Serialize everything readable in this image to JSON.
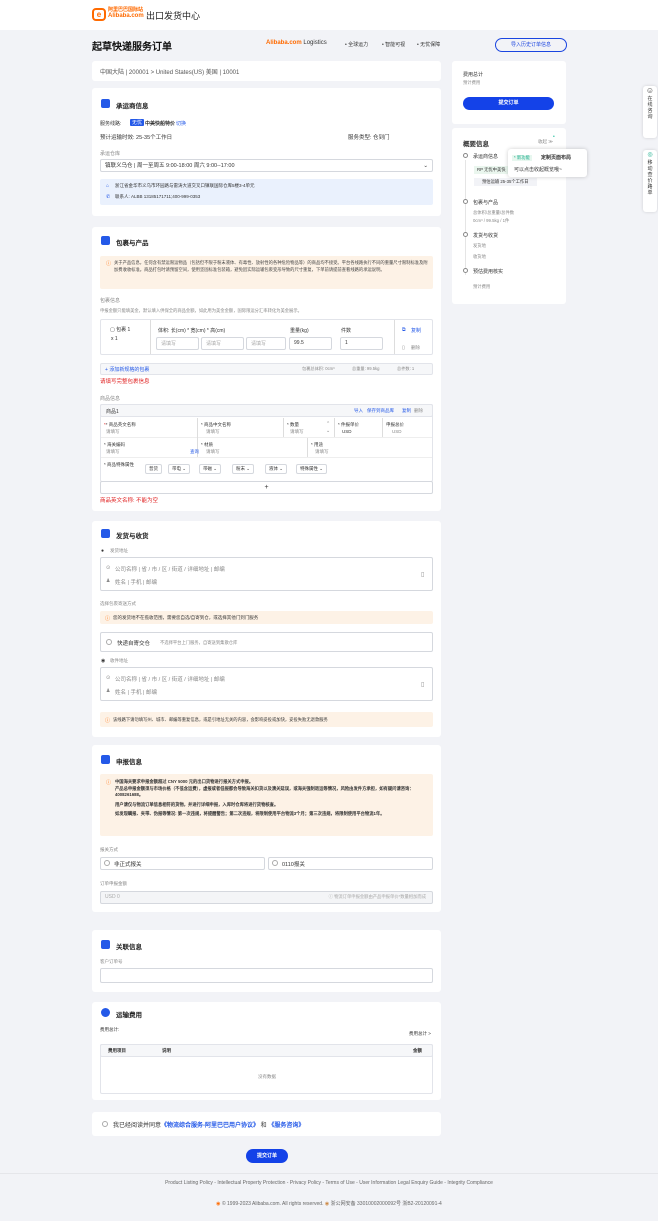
{
  "header": {
    "logo_cn": "阿里巴巴国际站",
    "logo_en": "Alibaba.com",
    "title": "出口发货中心"
  },
  "page": {
    "title": "起草快递服务订单",
    "brand_a": "Alibaba.com",
    "brand_b": " Logistics",
    "features": [
      "• 全球运力",
      "• 智能可视",
      "• 无忧保障"
    ],
    "import_history": "导入历史订单信息"
  },
  "route": "中国大陆 | 200001 > United States(US) 美国 | 10001",
  "carrier": {
    "title": "承运商信息",
    "service_label": "服务线路:",
    "tag": "无忧",
    "service": "中美快船特价",
    "switch": "切换",
    "time": "预计运输时效: 25-35个工作日",
    "type": "服务类型: 仓到门",
    "warehouse_label": "承运仓库",
    "warehouse": "镇联义乌仓 | 周一至周五 9:00-18:00 周六 9:00--17:00",
    "address": "浙江省金华市义乌市环园路与雷涛大道交叉口镇联国际仓库5楼3-4单元",
    "contact": "联系人: ALBB 13185171711;400-999-0353"
  },
  "packages": {
    "title": "包裹与产品",
    "notice": "关于产品信息，任何含有禁运限运物品（包括但不限于粉末液体、有毒性、放射性的各种危险物品等）的商品均不接受。平台各线路执行不同的重量尺寸限制标准及附加费收收标准。商品打包时请预留空间，使用坚固标准包装箱，避免因实际运输包裹变形导致的尺寸重复，下单前请提前查看线路的承运说明。",
    "info_label": "包裹信息",
    "info_hint": "申报金额只能填美金，默认填入供保全的商品金额，如此用为美金金额，国际限运分汇率转化为美金展示。",
    "pkg_name": "包裹 1",
    "pkg_qty": "x 1",
    "dims_label": "体积: 长(cm) * 宽(cm) * 高(cm)",
    "weight_label": "重量(kg)",
    "count_label": "件数",
    "ph": "请填写",
    "weight": "99.5",
    "count": "1",
    "copy": "复制",
    "delete": "删除",
    "add": "添加新规格的包裹",
    "total_vol": "包裹总体积: 0cm³",
    "total_weight": "总重量: 99.5kg",
    "total_count": "总件数: 1",
    "error1": "请填写完整包裹信息",
    "goods_label": "商品信息",
    "goods1": "商品1",
    "import": "导入",
    "save": "保存到商品库",
    "copy2": "复制",
    "delete2": "删除",
    "en_name": "* 商品英文名称",
    "cn_name": "* 商品中文名称",
    "qty": "* 数量",
    "unit_price": "* 件报单价",
    "price_total": "申报总价",
    "usd": "USD",
    "customs_code": "* 海关编码",
    "query": "查询",
    "material": "* 材质",
    "purpose": "* 用途",
    "attr": "* 商品特殊属性",
    "attrs": [
      "普货",
      "带电",
      "带磁",
      "粉末",
      "液体",
      "特殊属性"
    ],
    "plus": "+",
    "error2": "商品英文名称: 不能为空"
  },
  "shipping": {
    "title": "发货与收货",
    "sender_label": "发货地址",
    "addr_ph": "公司名称  |  省 / 市 / 区 / 街道 / 详细地址  |  邮编",
    "person_ph": "姓名  |  手机  |  邮编",
    "method_label": "选择包裹寄送方式",
    "method_note": "您的发货地不在揽收范围，需要您自选/自寄到仓，或选择其他门到门服务",
    "method": "快递自寄交仓",
    "method_hint": "不选择平台上门服务，自寄送到集散仓库",
    "receiver_label": "收件地址",
    "warn": "该线路下请勿填写州、城市、邮编等重复信息，或是引地址无关的内容，会影响妥投或加快，妥投失败无退款服务"
  },
  "declare": {
    "title": "申报信息",
    "notice1": "中国海关要求申报金额超过 CNY 5000 元的出口货物进行报关方式申报。",
    "notice2": "产品总申报金额须与市场价格（不低含运费），虚报或者低报都会导致海关扣货以及清关延误，或海关强制退运等情况，风险由发件方承担，如有疑问请咨询：4008261688。",
    "notice3": "用户请仅与物流订单信息相符的货物，并进行详细申报，入库时仓库将进行货物核查。",
    "notice4": "如发现瞒报、夹带、伪报等情况: 第一次违规，将提醒警告；第二次违规，将限制使用平台物流3个月；第三次违规，将限制使用平台物流1年。",
    "method_label": "报关方式",
    "opt1": "非正式报关",
    "opt2": "0110报关",
    "amount_label": "订单申报金额",
    "amount_ph": "USD  0",
    "amount_hint": "物流订单申报金额由产品申报单价*数量相加而成"
  },
  "related": {
    "title": "关联信息",
    "label": "客户订单号"
  },
  "fee": {
    "title": "运输费用",
    "label": "费用总计:",
    "detail": "费用总计 >",
    "col1": "费用项目",
    "col2": "说明",
    "col3": "金额",
    "empty": "没有数据"
  },
  "agree": {
    "text1": "我已经阅读并同意",
    "link1": "《物流综合服务-阿里巴巴用户协议》",
    "and": " 和 ",
    "link2": "《服务咨询》"
  },
  "submit": "提交订单",
  "sidebar": {
    "total_label": "费用总计",
    "est_label": "预计费用",
    "submit": "提交订单",
    "overview": "概要信息",
    "collapse": "收起 ≫",
    "items": [
      {
        "title": "承运商信息",
        "sub": "预估运输 25-35个工作日",
        "tag": "RP 无忧中美快"
      },
      {
        "title": "包裹与产品",
        "sub": "总体积/总重量/总件数",
        "sub2": "0cm³ / 99.5kg / 1件"
      },
      {
        "title": "发货与收货",
        "sub": "发货地",
        "sub2": "收货地"
      },
      {
        "title": "预估费用核实",
        "sub": "预计费用"
      }
    ],
    "tooltip_new": "* 新功能",
    "tooltip_title": "定制页面布局",
    "tooltip_text": "可以点击收起概览哦~"
  },
  "float": {
    "consult": "在线咨询",
    "calc": "移动查价路单"
  },
  "footer": {
    "links": "Product Listing Policy - Intellectual Property Protection - Privacy Policy - Terms of Use - User Information Legal Enquiry Guide - Integrity Compliance",
    "copy": "© 1999-2023 Alibaba.com. All rights reserved.",
    "beian": "浙公网安备 33010002000092号  浙B2-20120091-4"
  },
  "colors": {
    "brand": "#ff6a00",
    "primary": "#1442e8",
    "error": "#e02020"
  }
}
